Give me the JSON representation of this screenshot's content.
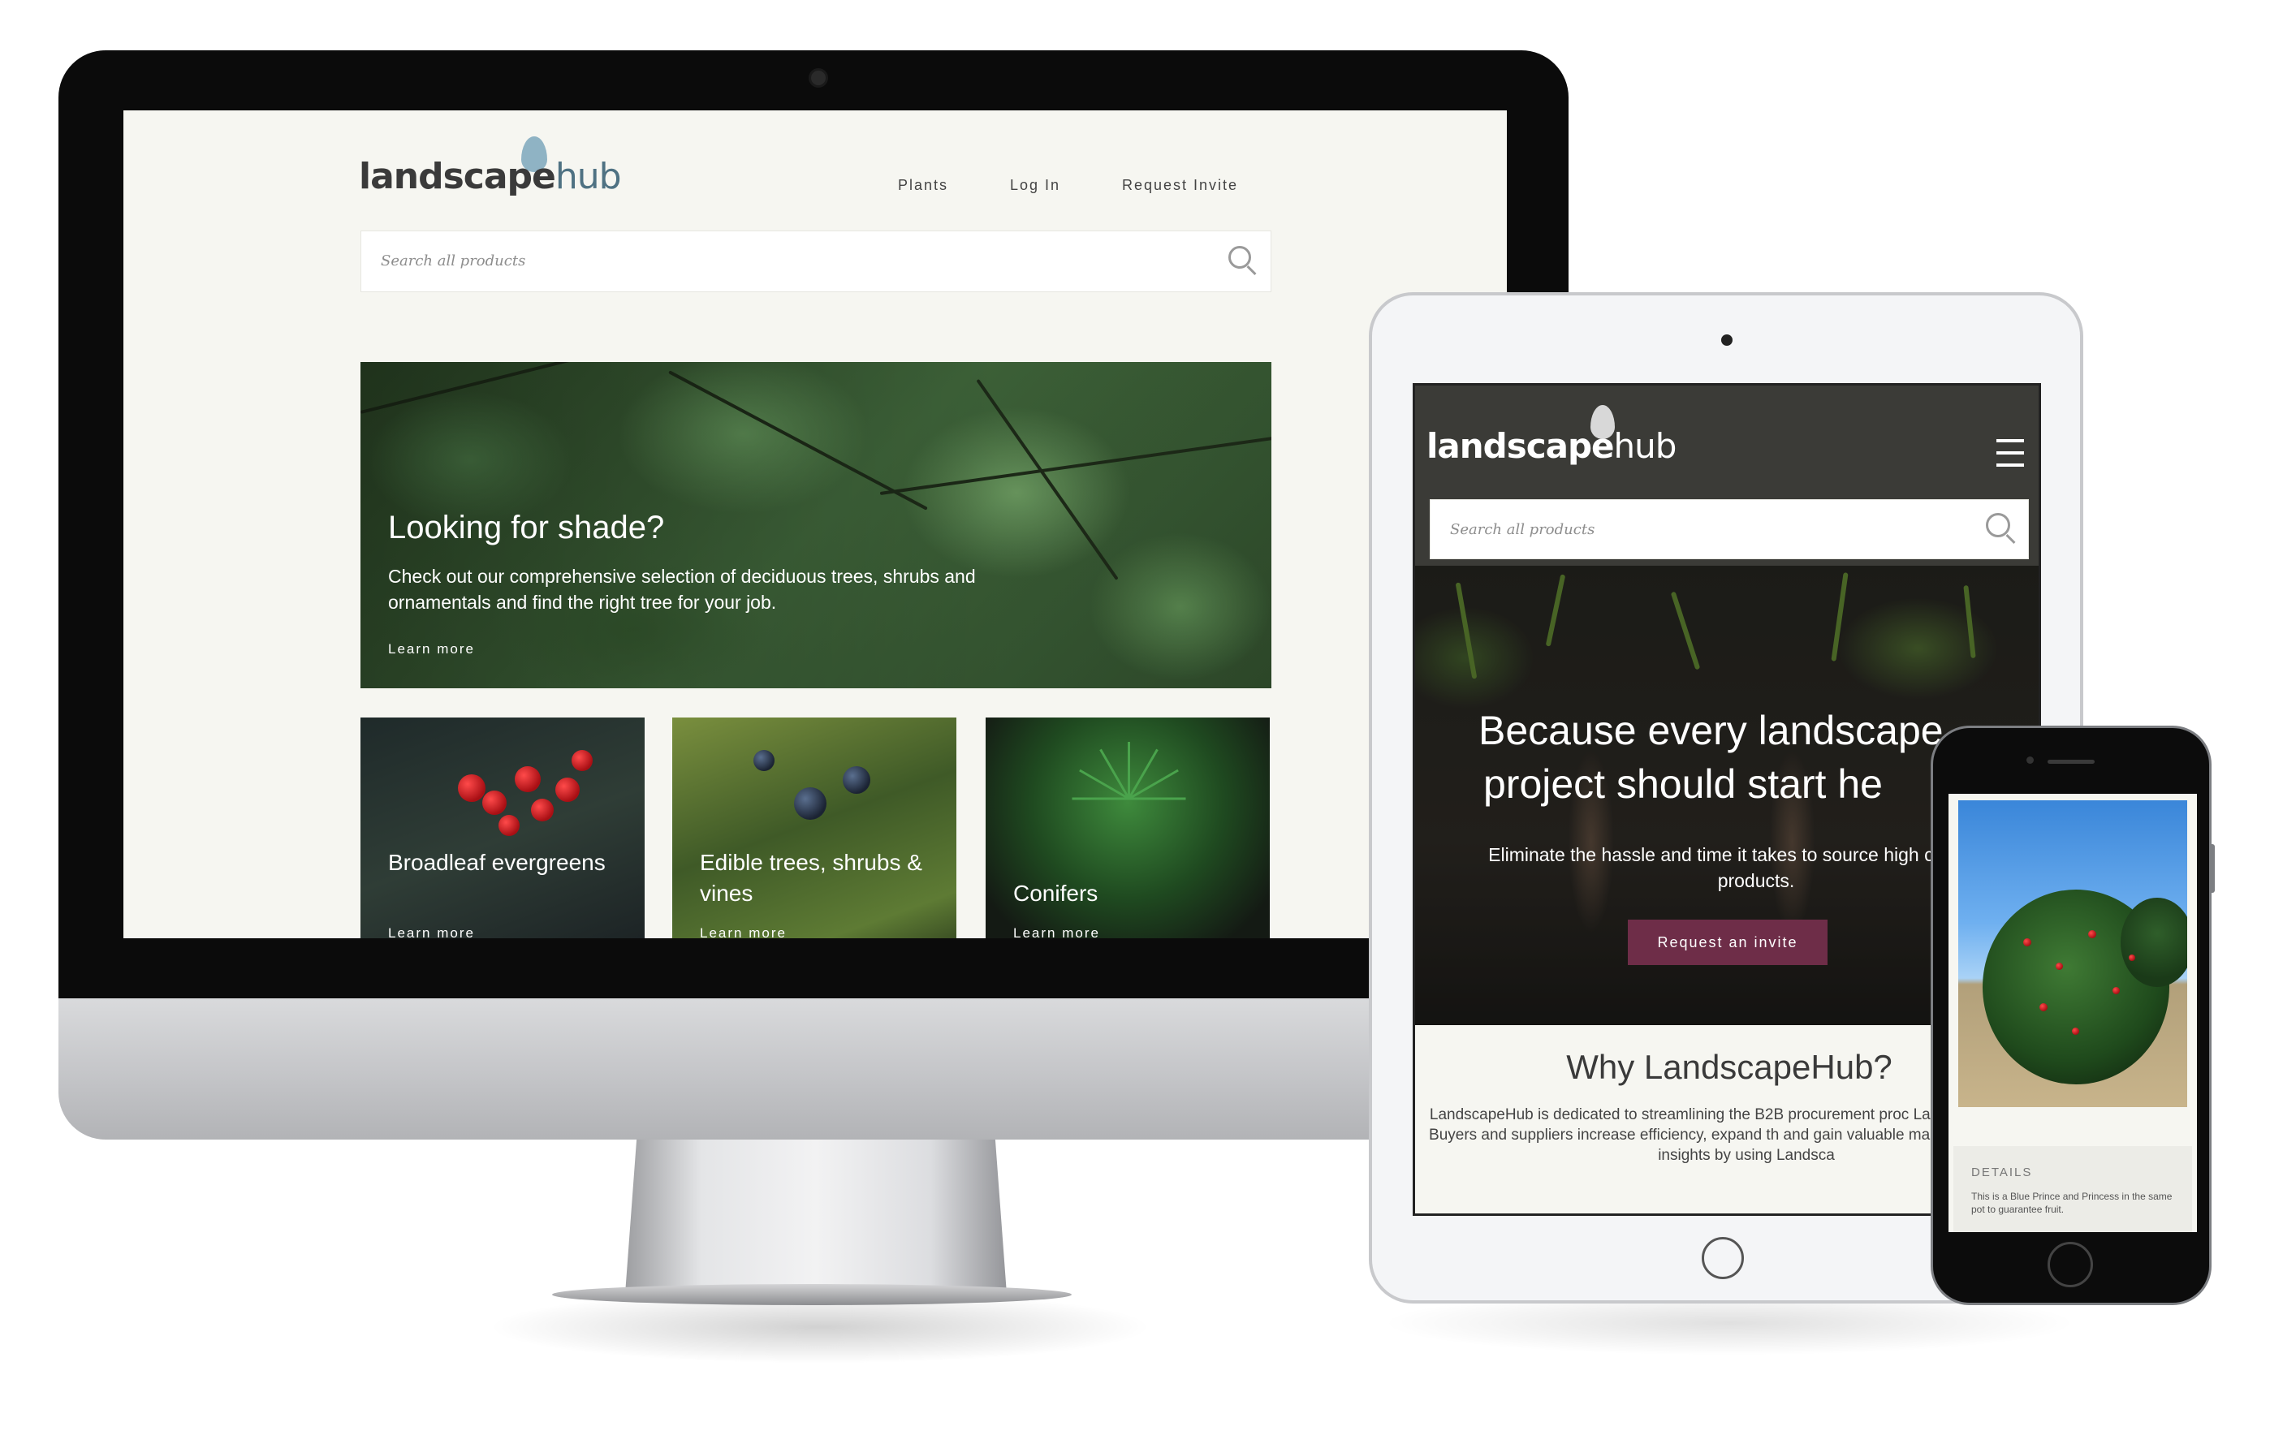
{
  "brand": {
    "word": "landscape",
    "suffix": "hub"
  },
  "desktop": {
    "nav": [
      "Plants",
      "Log In",
      "Request Invite"
    ],
    "search_placeholder": "Search all products",
    "hero": {
      "title": "Looking for shade?",
      "text": "Check out our comprehensive selection of deciduous trees, shrubs and ornamentals and find the right tree for your job.",
      "link": "Learn more"
    },
    "tiles": [
      {
        "title": "Broadleaf evergreens",
        "link": "Learn more"
      },
      {
        "title": "Edible trees, shrubs & vines",
        "link": "Learn more"
      },
      {
        "title": "Conifers",
        "link": "Learn more"
      }
    ]
  },
  "tablet": {
    "search_placeholder": "Search all products",
    "hero": {
      "title_line1": "Because every landscape",
      "title_line2": "project should start he",
      "text": "Eliminate the hassle and time it takes to source high c landscape products.",
      "cta": "Request an invite"
    },
    "why": {
      "title": "Why LandscapeHub?",
      "text": "LandscapeHub is dedicated to streamlining the B2B procurement proc Landscaping Industry. Buyers and suppliers increase efficiency, expand th and gain valuable market knowledge and insights by using Landsca"
    }
  },
  "phone": {
    "details_label": "DETAILS",
    "details_text": "This is a Blue Prince and Princess in the same pot to guarantee fruit."
  },
  "colors": {
    "accent": "#6e2d48",
    "brand_blue": "#4f7283",
    "leaf": "#8fb3c4"
  }
}
